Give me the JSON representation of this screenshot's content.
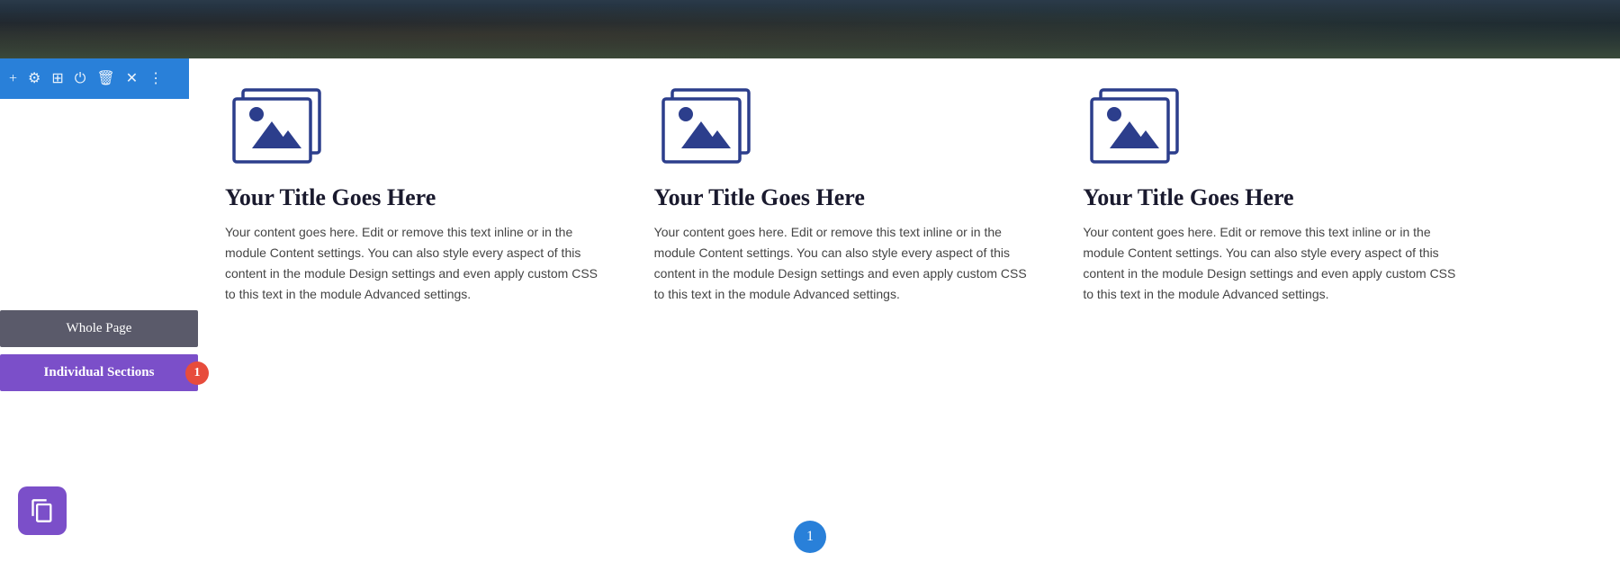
{
  "header": {
    "alt": "Scenic bridge header image"
  },
  "toolbar": {
    "icons": [
      {
        "name": "add-icon",
        "symbol": "+",
        "interactable": true
      },
      {
        "name": "settings-icon",
        "symbol": "⚙",
        "interactable": true
      },
      {
        "name": "duplicate-icon",
        "symbol": "⊡",
        "interactable": true
      },
      {
        "name": "power-icon",
        "symbol": "⏻",
        "interactable": true
      },
      {
        "name": "delete-icon",
        "symbol": "🗑",
        "interactable": true
      },
      {
        "name": "close-icon",
        "symbol": "✕",
        "interactable": true
      },
      {
        "name": "more-icon",
        "symbol": "⋮",
        "interactable": true
      }
    ]
  },
  "sidebar": {
    "whole_page_label": "Whole Page",
    "individual_sections_label": "Individual Sections",
    "badge_count": "1"
  },
  "columns": [
    {
      "title": "Your Title Goes Here",
      "body": "Your content goes here. Edit or remove this text inline or in the module Content settings. You can also style every aspect of this content in the module Design settings and even apply custom CSS to this text in the module Advanced settings."
    },
    {
      "title": "Your Title Goes Here",
      "body": "Your content goes here. Edit or remove this text inline or in the module Content settings. You can also style every aspect of this content in the module Design settings and even apply custom CSS to this text in the module Advanced settings."
    },
    {
      "title": "Your Title Goes Here",
      "body": "Your content goes here. Edit or remove this text inline or in the module Content settings. You can also style every aspect of this content in the module Design settings and even apply custom CSS to this text in the module Advanced settings."
    }
  ],
  "fab": {
    "name": "copy-icon"
  },
  "pagination": {
    "current": "1"
  },
  "colors": {
    "toolbar_bg": "#2980d9",
    "whole_page_bg": "#5a5a6a",
    "individual_sections_bg": "#7b4fc9",
    "badge_bg": "#e74c3c",
    "icon_color": "#2c3e8c"
  }
}
